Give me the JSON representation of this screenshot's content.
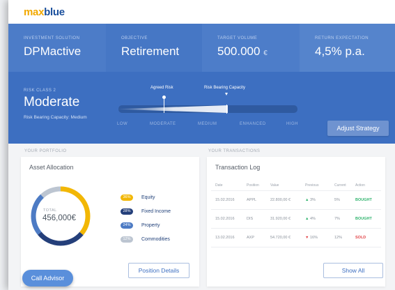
{
  "brand": {
    "logo_part1": "max",
    "logo_part2": "blue"
  },
  "summary": [
    {
      "label": "INVESTMENT SOLUTION",
      "value": "DPMactive",
      "unit": ""
    },
    {
      "label": "OBJECTIVE",
      "value": "Retirement",
      "unit": ""
    },
    {
      "label": "TARGET VOLUME",
      "value": "500.000",
      "unit": "€"
    },
    {
      "label": "RETURN EXPECTATION",
      "value": "4,5% p.a.",
      "unit": ""
    }
  ],
  "risk": {
    "label": "RISK CLASS 2",
    "value": "Moderate",
    "subtext": "Risk Bearing Capacity: Medium",
    "agreed_label": "Agreed Risk",
    "capacity_label": "Risk Bearing Capacity",
    "scale": [
      "LOW",
      "MODERATE",
      "MEDIUM",
      "ENHANCED",
      "HIGH"
    ],
    "agreed_level": "MODERATE",
    "capacity_level": "MEDIUM",
    "adjust_button": "Adjust Strategy"
  },
  "portfolio": {
    "section_label": "YOUR PORTFOLIO",
    "title": "Asset Allocation",
    "total_label": "TOTAL",
    "total_value": "456,000€",
    "allocation": [
      {
        "percent": 36,
        "percent_label": "36%",
        "name": "Equity",
        "color": "#f2b705"
      },
      {
        "percent": 28,
        "percent_label": "28%",
        "name": "Fixed Income",
        "color": "#243f7a"
      },
      {
        "percent": 24,
        "percent_label": "24%",
        "name": "Property",
        "color": "#4d7bc4"
      },
      {
        "percent": 12,
        "percent_label": "12%",
        "name": "Commodities",
        "color": "#bcc5d1"
      }
    ],
    "details_button": "Position Details"
  },
  "transactions": {
    "section_label": "YOUR TRANSACTIONS",
    "title": "Transaction Log",
    "columns": [
      "Date",
      "Position",
      "Value",
      "Previous",
      "Current",
      "Action"
    ],
    "rows": [
      {
        "date": "15.02.2016",
        "position": "APPL",
        "value": "22.800,00 €",
        "direction": "up",
        "previous": "3%",
        "current": "5%",
        "action": "BOUGHT"
      },
      {
        "date": "15.02.2016",
        "position": "DIS",
        "value": "31.920,00 €",
        "direction": "up",
        "previous": "4%",
        "current": "7%",
        "action": "BOUGHT"
      },
      {
        "date": "13.02.2016",
        "position": "AXP",
        "value": "54.720,00 €",
        "direction": "down",
        "previous": "16%",
        "current": "12%",
        "action": "SOLD"
      }
    ],
    "show_all_button": "Show All"
  },
  "call_advisor": "Call Advisor"
}
